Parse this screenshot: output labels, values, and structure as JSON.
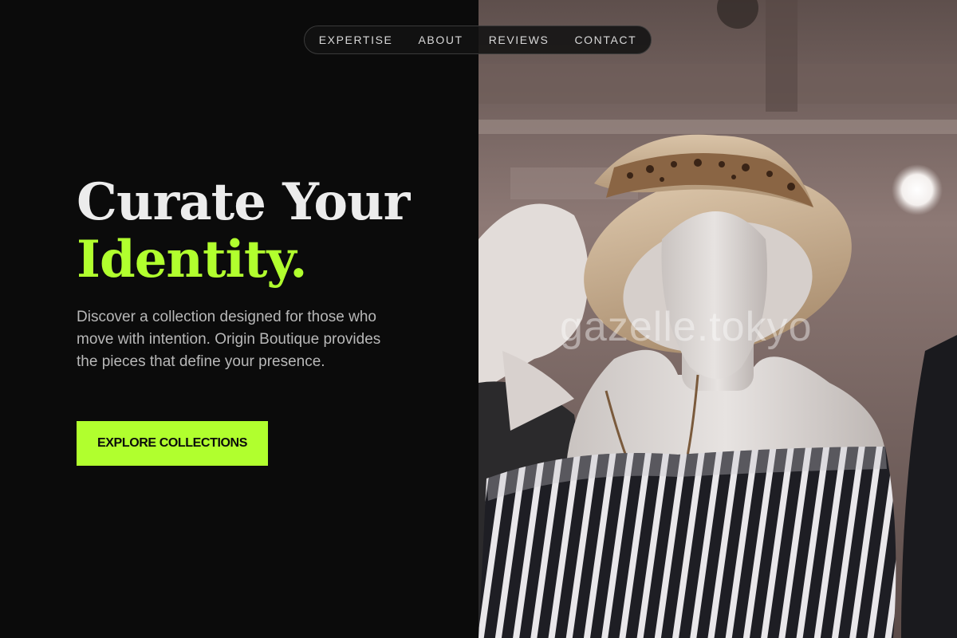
{
  "nav": {
    "items": [
      {
        "label": "EXPERTISE"
      },
      {
        "label": "ABOUT"
      },
      {
        "label": "REVIEWS"
      },
      {
        "label": "CONTACT"
      }
    ]
  },
  "hero": {
    "headline_line1": "Curate Your",
    "headline_line2": "Identity.",
    "description": "Discover a collection designed for those who move with intention. Origin Boutique provides the pieces that define your presence.",
    "cta_label": "EXPLORE COLLECTIONS"
  },
  "photo": {
    "watermark": "gazelle.tokyo"
  },
  "colors": {
    "accent": "#b1ff2e",
    "background": "#0b0b0b",
    "headline": "#ececec",
    "body_text": "#b8b8b8"
  }
}
